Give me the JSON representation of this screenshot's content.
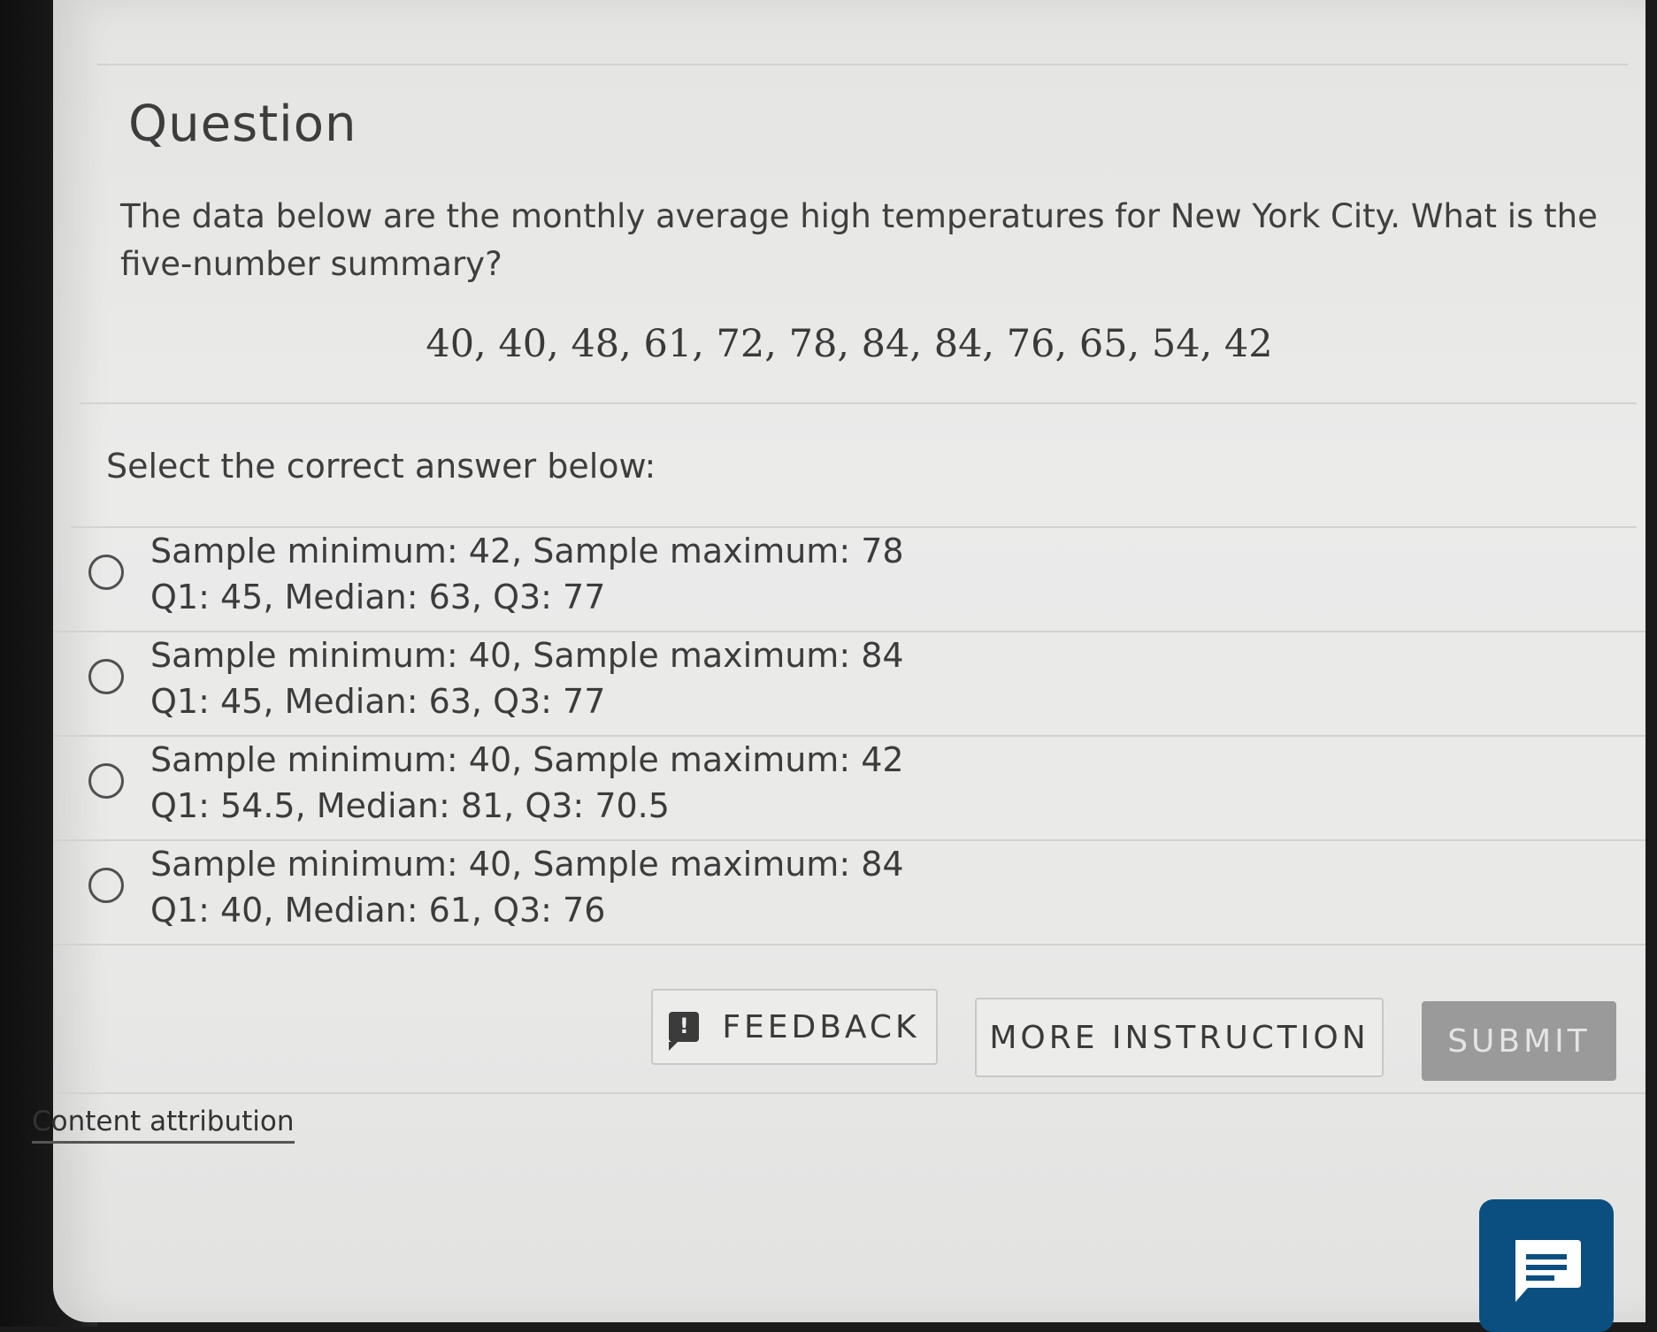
{
  "question": {
    "title": "Question",
    "text": "The data below are the monthly average high temperatures for New York City. What is the five-number summary?",
    "data_values": "40, 40, 48, 61, 72, 78, 84, 84, 76, 65, 54, 42"
  },
  "instruction": "Select the correct answer below:",
  "options": [
    {
      "line1": "Sample minimum: 42, Sample maximum: 78",
      "line2": "Q1: 45, Median: 63, Q3: 77"
    },
    {
      "line1": "Sample minimum: 40, Sample maximum: 84",
      "line2": "Q1: 45, Median: 63, Q3: 77"
    },
    {
      "line1": "Sample minimum: 40, Sample maximum: 42",
      "line2": "Q1: 54.5, Median: 81, Q3: 70.5"
    },
    {
      "line1": "Sample minimum: 40, Sample maximum: 84",
      "line2": "Q1: 40, Median: 61, Q3: 76"
    }
  ],
  "buttons": {
    "feedback": "FEEDBACK",
    "more_instruction": "MORE INSTRUCTION",
    "submit": "SUBMIT"
  },
  "footer": {
    "attribution": "Content attribution"
  },
  "icons": {
    "feedback": "feedback-icon",
    "chat": "chat-icon",
    "radio": "radio-icon"
  },
  "colors": {
    "submit_disabled": "#9a9a9a",
    "chat_button": "#0b4f80"
  }
}
